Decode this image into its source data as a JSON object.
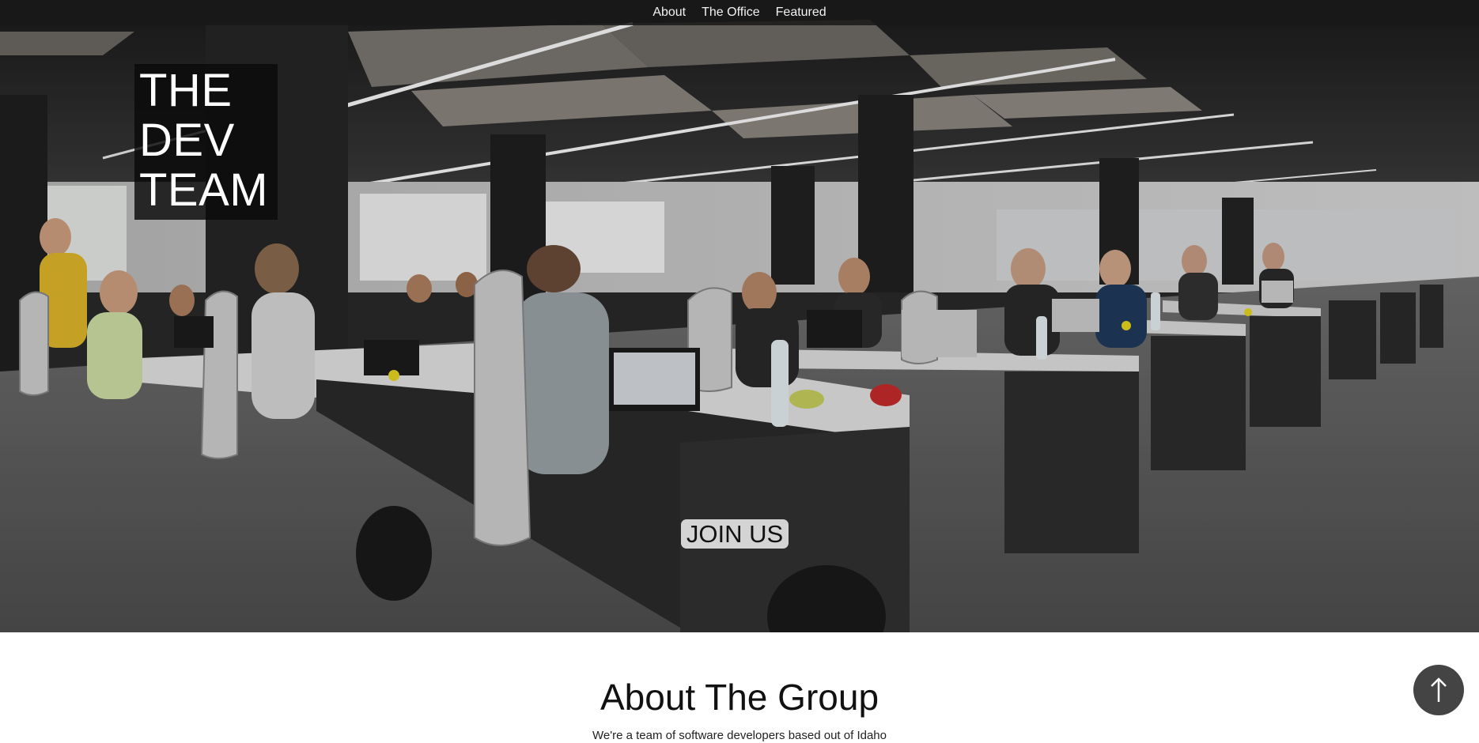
{
  "nav": {
    "items": [
      {
        "label": "About"
      },
      {
        "label": "The Office"
      },
      {
        "label": "Featured"
      }
    ]
  },
  "hero": {
    "brand_lines": [
      "THE",
      "DEV",
      "TEAM"
    ],
    "cta_label": "JOIN US",
    "image_icon": "office-photo"
  },
  "about": {
    "title": "About The Group",
    "text": "We're a team of software developers based out of Idaho"
  },
  "scroll_top": {
    "icon": "arrow-up-icon"
  },
  "colors": {
    "nav_bg": "#181818",
    "cta_bg": "#d4d4d4",
    "scroll_btn_bg": "#444444"
  }
}
